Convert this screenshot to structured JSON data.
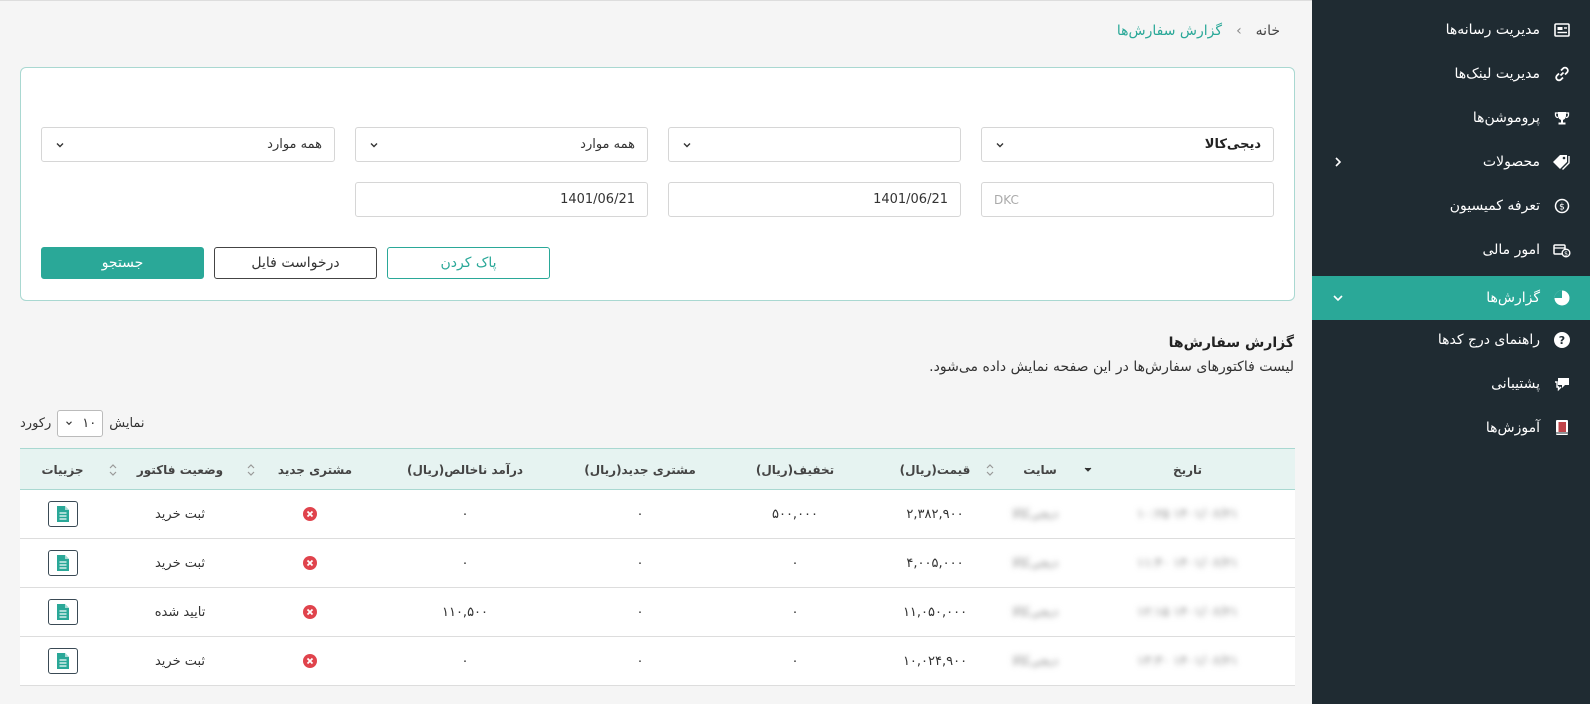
{
  "sidebar": {
    "items": [
      {
        "label": "مدیریت رسانه‌ها",
        "icon": "media-icon"
      },
      {
        "label": "مدیریت لینک‌ها",
        "icon": "link-icon"
      },
      {
        "label": "پروموشن‌ها",
        "icon": "trophy-icon"
      },
      {
        "label": "محصولات",
        "icon": "tag-icon"
      },
      {
        "label": "تعرفه کمیسیون",
        "icon": "dollar-icon"
      },
      {
        "label": "امور مالی",
        "icon": "money-icon"
      },
      {
        "label": "گزارش‌ها",
        "icon": "pie-chart-icon"
      },
      {
        "label": "راهنمای درج کدها",
        "icon": "help-icon"
      },
      {
        "label": "پشتیبانی",
        "icon": "chat-icon"
      },
      {
        "label": "آموزش‌ها",
        "icon": "book-icon"
      }
    ],
    "accent": "#2aa898",
    "bg": "#1f2b32"
  },
  "breadcrumb": {
    "home": "خانه",
    "current": "گزارش سفارش‌ها"
  },
  "filters": {
    "site": "دیجی‌کالا",
    "select2": "",
    "select3": "همه موارد",
    "select4": "همه موارد",
    "code_placeholder": "DKC",
    "date_from": "1401/06/21",
    "date_to": "1401/06/21"
  },
  "buttons": {
    "search": "جستجو",
    "file": "درخواست فایل",
    "clear": "پاک کردن"
  },
  "section": {
    "title": "گزارش سفارش‌ها",
    "desc": "لیست فاکتورهای سفارش‌ها در این صفحه نمایش داده می‌شود."
  },
  "length": {
    "show": "نمایش",
    "value": "۱۰",
    "records": "رکورد"
  },
  "table": {
    "headers": [
      "تاریخ",
      "سایت",
      "قیمت(ریال)",
      "تخفیف(ریال)",
      "مشتری جدید(ریال)",
      "درآمد ناخالص(ریال)",
      "مشتری جدید",
      "وضعیت فاکتور",
      "جزییات"
    ],
    "rows": [
      {
        "date": "۱۴۰۱/۰۶/۲۱ ۱۰:۲۵",
        "site": "دیجی‌کالا",
        "price": "۲,۳۸۲,۹۰۰",
        "discount": "۵۰۰,۰۰۰",
        "new_customer_amount": "۰",
        "gross": "۰",
        "status": "ثبت خرید"
      },
      {
        "date": "۱۴۰۱/۰۶/۲۱ ۱۱:۴۰",
        "site": "دیجی‌کالا",
        "price": "۴,۰۰۵,۰۰۰",
        "discount": "۰",
        "new_customer_amount": "۰",
        "gross": "۰",
        "status": "ثبت خرید"
      },
      {
        "date": "۱۴۰۱/۰۶/۲۱ ۱۲:۱۵",
        "site": "دیجی‌کالا",
        "price": "۱۱,۰۵۰,۰۰۰",
        "discount": "۰",
        "new_customer_amount": "۰",
        "gross": "۱۱۰,۵۰۰",
        "status": "تایید شده"
      },
      {
        "date": "۱۴۰۱/۰۶/۲۱ ۱۳:۳۰",
        "site": "دیجی‌کالا",
        "price": "۱۰,۰۲۴,۹۰۰",
        "discount": "۰",
        "new_customer_amount": "۰",
        "gross": "۰",
        "status": "ثبت خرید"
      }
    ]
  }
}
